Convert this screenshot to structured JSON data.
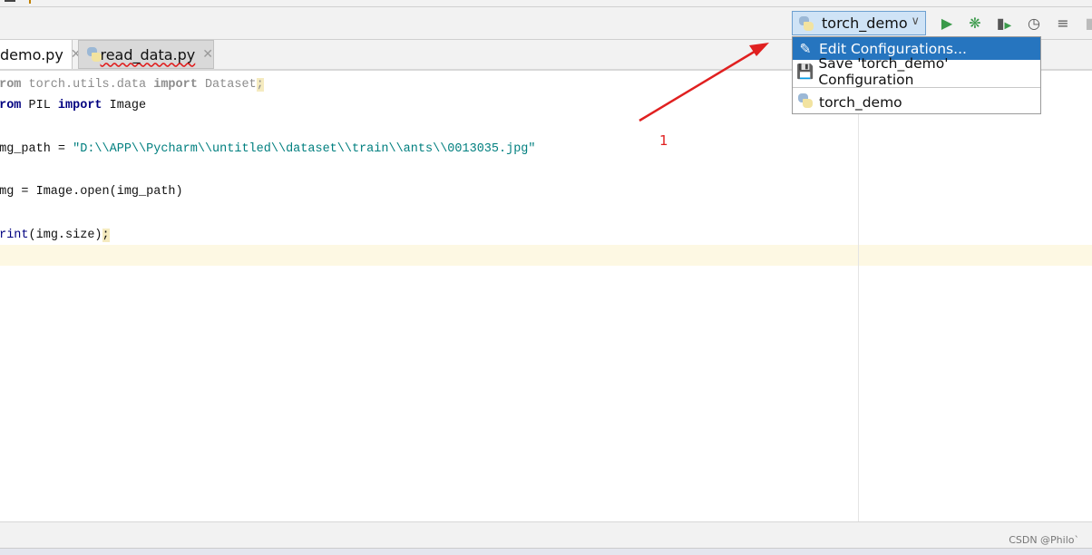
{
  "toolbar": {
    "run_config": "torch_demo",
    "buttons": [
      "run-icon",
      "debug-icon",
      "coverage-icon",
      "profile-icon",
      "concurrency-icon"
    ]
  },
  "tabs": [
    {
      "label": "demo.py",
      "active": true
    },
    {
      "label": "read_data.py",
      "active": false
    }
  ],
  "code": {
    "line1": {
      "kw1": "from",
      "mod": " torch.utils.data ",
      "kw2": "import",
      "name": " Dataset",
      "semi": ";"
    },
    "line2": {
      "kw1": "from",
      "mod": " PIL ",
      "kw2": "import",
      "name": " Image"
    },
    "line4": {
      "lhs": "img_path = ",
      "str": "\"D:\\\\APP\\\\Pycharm\\\\untitled\\\\dataset\\\\train\\\\ants\\\\0013035.jpg\""
    },
    "line6": "img = Image.open(img_path)",
    "line8": {
      "fn": "print",
      "rest": "(img.size)",
      "semi": ";"
    }
  },
  "menu": {
    "items": [
      {
        "label": "Edit Configurations...",
        "icon": "pencil-icon",
        "selected": true
      },
      {
        "label": "Save 'torch_demo' Configuration",
        "icon": "save-icon"
      },
      {
        "label": "torch_demo",
        "icon": "python-icon"
      }
    ]
  },
  "annotation": {
    "label": "1",
    "color": "#e02020"
  },
  "watermark": "CSDN @Philo`",
  "colors": {
    "selection": "#2675bf",
    "run_green": "#3a9a4a",
    "current_line": "#fdf8e3"
  }
}
